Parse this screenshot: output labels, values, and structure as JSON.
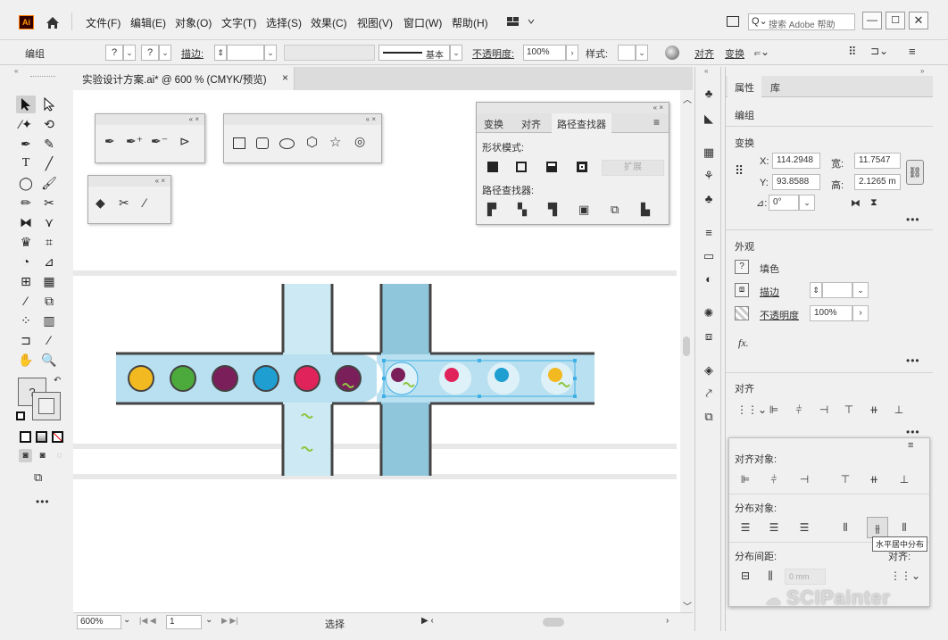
{
  "app": {
    "logo": "Ai"
  },
  "menu": [
    "文件(F)",
    "编辑(E)",
    "对象(O)",
    "文字(T)",
    "选择(S)",
    "效果(C)",
    "视图(V)",
    "窗口(W)",
    "帮助(H)"
  ],
  "search": {
    "placeholder": "搜索 Adobe 帮助"
  },
  "control": {
    "group_label": "编组",
    "stroke_label": "描边:",
    "stroke_style": "基本",
    "opacity_label": "不透明度:",
    "opacity_value": "100%",
    "style_label": "样式:",
    "align_link": "对齐",
    "transform_link": "变换"
  },
  "document": {
    "tab_title": "实验设计方案.ai* @ 600 % (CMYK/预览)",
    "close": "×"
  },
  "status": {
    "zoom": "600%",
    "page": "1",
    "tool": "选择"
  },
  "pathfinder": {
    "tabs": [
      "变换",
      "对齐",
      "路径查找器"
    ],
    "shape_modes": "形状模式:",
    "expand": "扩展",
    "pathfinders": "路径查找器:"
  },
  "props": {
    "tabs": [
      "属性",
      "库"
    ],
    "kind": "编组",
    "transform": "变换",
    "x_label": "X:",
    "x": "114.2948",
    "w_label": "宽:",
    "w": "11.7547",
    "y_label": "Y:",
    "y": "93.8588",
    "h_label": "高:",
    "h": "2.1265 m",
    "angle": "0°",
    "appearance": "外观",
    "fill": "填色",
    "stroke": "描边",
    "opacity": "不透明度",
    "opacity_val": "100%",
    "fx": "fx.",
    "align": "对齐",
    "align_to": "对齐对象:",
    "distribute": "分布对象:",
    "distribute_spacing": "分布间距:",
    "align_to_short": "对齐:",
    "spacing_value": "0 mm",
    "tooltip": "水平居中分布"
  },
  "watermark": "SCIPainter",
  "colors": {
    "yellow": "#f2b921",
    "green": "#4caa3c",
    "purple": "#7b1f5b",
    "blue": "#1f9ed1",
    "red": "#e0245b",
    "light": "#cde9f3",
    "mid": "#8fc6dc",
    "track": "#b9e0f0",
    "wave": "#8dc63f"
  }
}
